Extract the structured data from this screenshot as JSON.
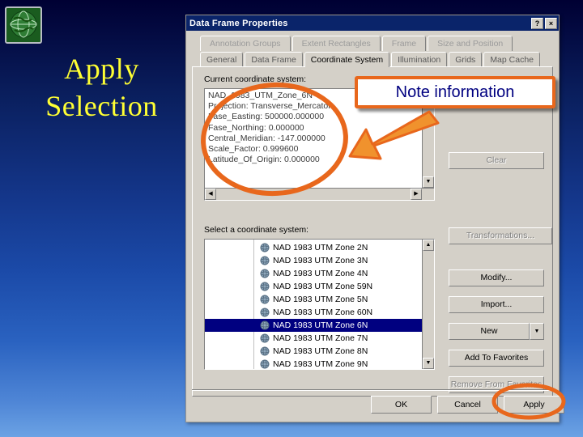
{
  "slide": {
    "headline_line1": "Apply",
    "headline_line2": "Selection",
    "logo_name": "globe-logo"
  },
  "dialog": {
    "title": "Data Frame Properties",
    "help_button": "?",
    "close_button": "×",
    "tabs_row1": [
      {
        "label": "Annotation Groups",
        "active": false
      },
      {
        "label": "Extent Rectangles",
        "active": false
      },
      {
        "label": "Frame",
        "active": false
      },
      {
        "label": "Size and Position",
        "active": false
      }
    ],
    "tabs_row2": [
      {
        "label": "General",
        "active": false
      },
      {
        "label": "Data Frame",
        "active": false
      },
      {
        "label": "Coordinate System",
        "active": true
      },
      {
        "label": "Illumination",
        "active": false
      },
      {
        "label": "Grids",
        "active": false
      },
      {
        "label": "Map Cache",
        "active": false
      }
    ],
    "current_cs_label": "Current coordinate system:",
    "current_cs_text": "NAD_1983_UTM_Zone_6N\nProjection: Transverse_Mercator\nFase_Easting: 500000.000000\nFase_Northing: 0.000000\nCentral_Meridian: -147.000000\nScale_Factor: 0.999600\nLatitude_Of_Origin: 0.000000",
    "clear_button": "Clear",
    "transformations_button": "Transformations...",
    "select_cs_label": "Select a coordinate system:",
    "list_items": [
      {
        "label": "NAD 1983 UTM Zone 2N",
        "selected": false
      },
      {
        "label": "NAD 1983 UTM Zone 3N",
        "selected": false
      },
      {
        "label": "NAD 1983 UTM Zone 4N",
        "selected": false
      },
      {
        "label": "NAD 1983 UTM Zone 59N",
        "selected": false
      },
      {
        "label": "NAD 1983 UTM Zone 5N",
        "selected": false
      },
      {
        "label": "NAD 1983 UTM Zone 60N",
        "selected": false
      },
      {
        "label": "NAD 1983 UTM Zone 6N",
        "selected": true
      },
      {
        "label": "NAD 1983 UTM Zone 7N",
        "selected": false
      },
      {
        "label": "NAD 1983 UTM Zone 8N",
        "selected": false
      },
      {
        "label": "NAD 1983 UTM Zone 9N",
        "selected": false
      }
    ],
    "side_buttons": [
      {
        "label": "Modify...",
        "disabled": false
      },
      {
        "label": "Import...",
        "disabled": false
      },
      {
        "label": "New",
        "disabled": false
      },
      {
        "label": "Add To Favorites",
        "disabled": false
      },
      {
        "label": "Remove From Favorites",
        "disabled": true
      }
    ],
    "new_dropdown_arrow": "▼",
    "bottom_buttons": [
      {
        "label": "OK"
      },
      {
        "label": "Cancel"
      },
      {
        "label": "Apply"
      }
    ]
  },
  "annotations": {
    "note_text": "Note information",
    "highlight_color": "#e8671c",
    "note_text_color": "#000080"
  }
}
